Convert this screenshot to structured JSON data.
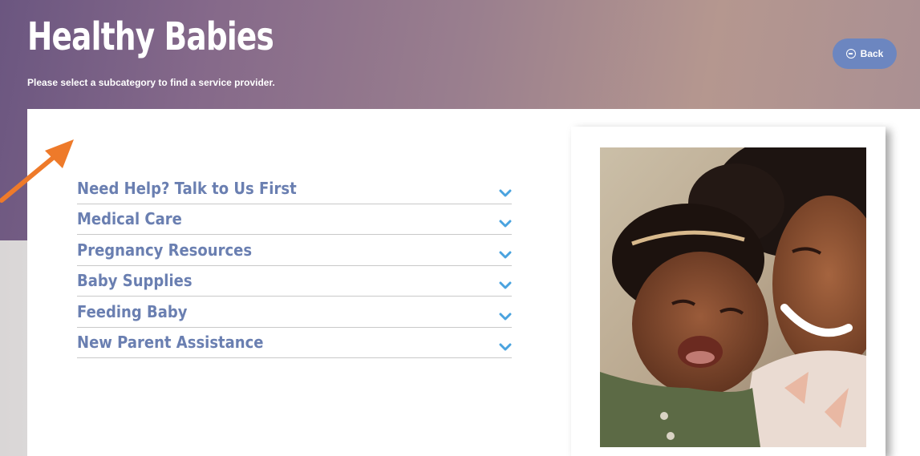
{
  "header": {
    "title": "Healthy Babies",
    "subtitle": "Please select a subcategory to find a service provider.",
    "back_label": "Back"
  },
  "accordion": {
    "items": [
      {
        "label": "Need Help? Talk to Us First",
        "icon": "chevron-down-icon"
      },
      {
        "label": "Medical Care",
        "icon": "chevron-down-icon"
      },
      {
        "label": "Pregnancy Resources",
        "icon": "chevron-down-icon"
      },
      {
        "label": "Baby Supplies",
        "icon": "chevron-down-icon"
      },
      {
        "label": "Feeding Baby",
        "icon": "chevron-down-icon"
      },
      {
        "label": "New Parent Assistance",
        "icon": "chevron-down-icon"
      }
    ]
  },
  "colors": {
    "accent": "#6a7fb1",
    "chevron": "#4aa3df",
    "back_button": "#6c86c0",
    "annotation_arrow": "#ee7a2a"
  },
  "photo": {
    "subject": "mother-and-baby-photo"
  }
}
